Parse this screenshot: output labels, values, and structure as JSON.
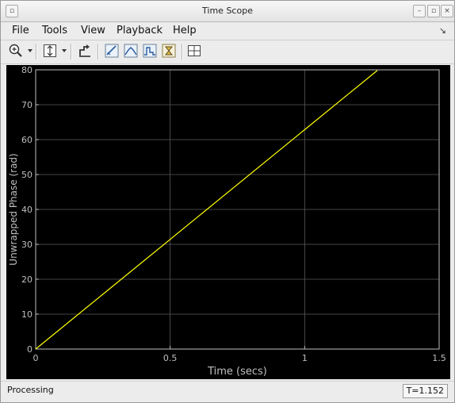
{
  "window": {
    "title": "Time Scope"
  },
  "menu": {
    "items": [
      "File",
      "Tools",
      "View",
      "Playback",
      "Help"
    ],
    "dock_icon": "dock-arrow-icon"
  },
  "toolbar": {
    "tools": [
      "zoom-in-icon",
      "scale-axes-icon",
      "restore-view-icon",
      "triggers-icon",
      "signal-statistics-icon",
      "peak-finder-icon",
      "bilevel-measurements-icon",
      "layout-icon"
    ]
  },
  "chart_data": {
    "type": "line",
    "title": "",
    "xlabel": "Time (secs)",
    "ylabel": "Unwrapped Phase (rad)",
    "xlim": [
      0,
      1.5
    ],
    "ylim": [
      0,
      80
    ],
    "xticks": [
      0,
      0.5,
      1,
      1.5
    ],
    "xtick_labels": [
      "0",
      "0.5",
      "1",
      "1.5"
    ],
    "yticks": [
      0,
      10,
      20,
      30,
      40,
      50,
      60,
      70,
      80
    ],
    "ytick_labels": [
      "0",
      "10",
      "20",
      "30",
      "40",
      "50",
      "60",
      "70",
      "80"
    ],
    "grid": true,
    "background": "#000000",
    "axis_color": "#bfbfbf",
    "series": [
      {
        "color": "#ffff00",
        "x": [
          0,
          1.152,
          1.27
        ],
        "y": [
          0,
          72.4,
          79.8
        ]
      }
    ]
  },
  "status": {
    "text": "Processing",
    "time": "T=1.152"
  }
}
